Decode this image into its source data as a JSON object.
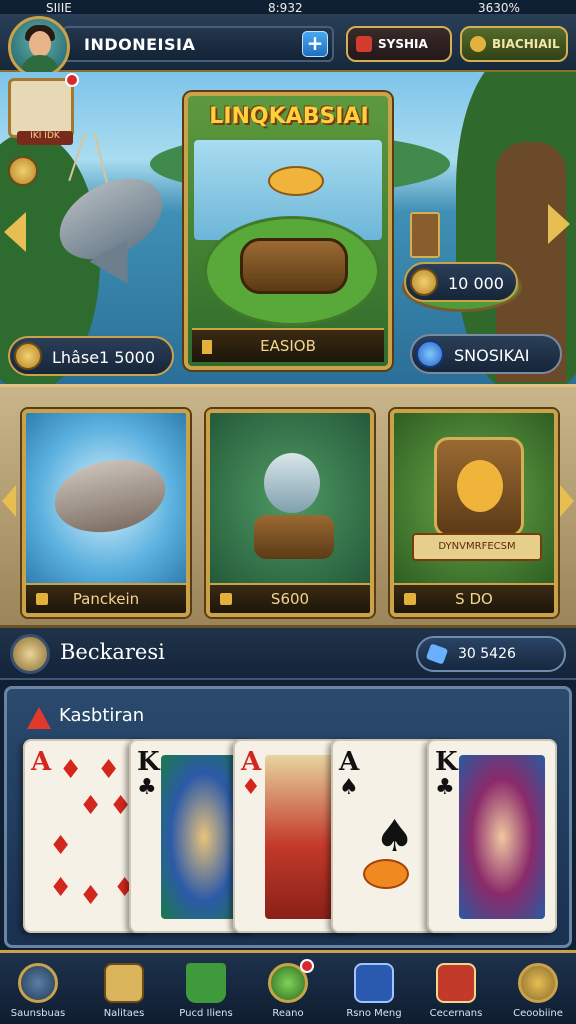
{
  "status_bar": {
    "carrier": "SIIIE",
    "time": "8:932",
    "battery": "3630%"
  },
  "header": {
    "username": "INDONEISIA",
    "buttons": [
      {
        "label": "SYSHIA",
        "icon": "shop-icon",
        "color": "#d23b2e"
      },
      {
        "label": "BIACHIAIL",
        "icon": "coin-icon",
        "color": "#556b2a"
      }
    ]
  },
  "scene": {
    "featured_title": "LINQKABSIAI",
    "featured_footer": "EASIOB",
    "badge_tag": "IKI IDK",
    "coins_right": "10 000",
    "left_balance": "Lhâse1 5000",
    "gems": "SNOSIKAI"
  },
  "game_cards": [
    {
      "label": "Panckein",
      "art": "fish-in-water"
    },
    {
      "label": "S600",
      "art": "fish-on-barrel"
    },
    {
      "label": "S DO",
      "art": "fish-crest",
      "ribbon": "DYNVMRFECSM"
    }
  ],
  "section": {
    "title": "Beckaresi",
    "value": "30 5426"
  },
  "cards_panel": {
    "title": "Kasbtiran",
    "cards": [
      {
        "rank": "A",
        "suit": "♦",
        "color": "red"
      },
      {
        "rank": "K",
        "suit": "♣",
        "color": "black"
      },
      {
        "rank": "A",
        "suit": "♦",
        "color": "red"
      },
      {
        "rank": "A",
        "suit": "♠",
        "color": "black"
      },
      {
        "rank": "K",
        "suit": "♣",
        "color": "black"
      }
    ]
  },
  "bottom_nav": [
    {
      "label": "Saunsbuas",
      "icon": "search-icon"
    },
    {
      "label": "Nalitaes",
      "icon": "map-icon"
    },
    {
      "label": "Pucd Iliens",
      "icon": "tree-icon"
    },
    {
      "label": "Reano",
      "icon": "home-icon"
    },
    {
      "label": "Rsno Meng",
      "icon": "chest-icon"
    },
    {
      "label": "Cecernans",
      "icon": "gift-icon"
    },
    {
      "label": "Ceoobiine",
      "icon": "settings-icon"
    }
  ],
  "colors": {
    "gold": "#c9a24a",
    "panel": "#1a3150",
    "accent_red": "#d23b2e"
  }
}
